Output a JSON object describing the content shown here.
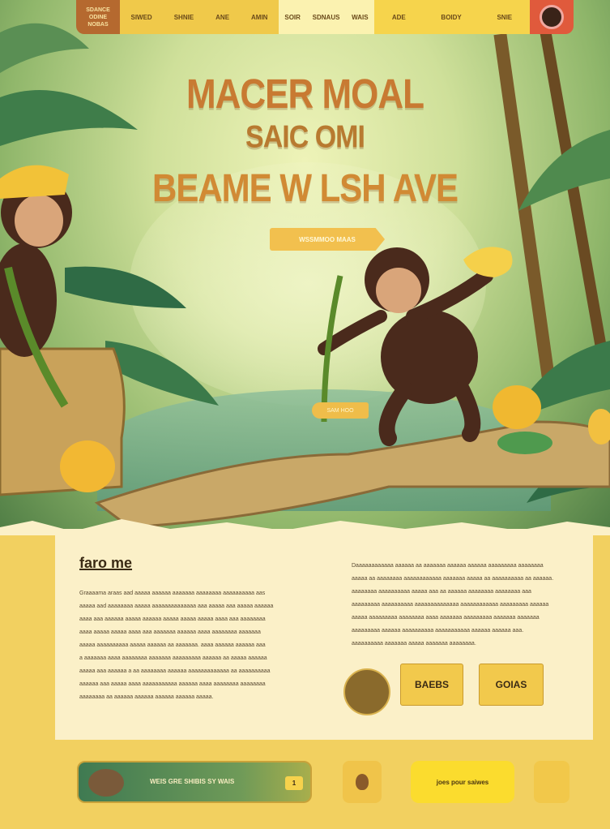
{
  "nav": {
    "logo_line1": "SDANCE",
    "logo_line2": "ODINE",
    "logo_line3": "NOBAS",
    "links_a": [
      "SIWED",
      "SHNIE",
      "ANE",
      "AMIN"
    ],
    "links_b": [
      "SOIR",
      "SDNAUS",
      "WAIS"
    ],
    "links_c": [
      "ADE",
      "BOIDY",
      "SNIE"
    ]
  },
  "hero": {
    "title_line1": "MACER MOAL",
    "title_line2": "SAIC OMI",
    "title_line3": "BEAME W LSH AVE",
    "cta_label": "WSSMMOO MAAS",
    "tag_label": "SAM HOO"
  },
  "card": {
    "heading": "faro me",
    "left_lines": [
      "Graaaama araas aad aaaaa aaaaaa aaaaaaa aaaaaaaa aaaaaaaaaa aas",
      "aaaaa aad aaaaaaaa aaaaa aaaaaaaaaaaaaa aaa aaaaa aaa aaaaa aaaaaa",
      "aaaa aaa aaaaaa aaaaa aaaaaa aaaaa aaaaa aaaaa aaaa aaa aaaaaaaa",
      "aaaa aaaaa aaaaa aaaa aaa aaaaaaa aaaaaa aaaa aaaaaaaa aaaaaaa",
      "aaaaa aaaaaaaaaa aaaaa aaaaaa aa aaaaaaa. aaaa aaaaaa aaaaaa aaa",
      "a aaaaaaa aaaa aaaaaaaa aaaaaaa aaaaaaaaa aaaaaa aa aaaaa aaaaaa",
      "aaaaa aaa aaaaaa a aa aaaaaaaa aaaaaa aaaaaaaaaaaaa aa aaaaaaaaaa",
      "aaaaaa aaa aaaaa aaaa aaaaaaaaaaa aaaaaa aaaa aaaaaaaa aaaaaaaa",
      "aaaaaaaa aa aaaaaa aaaaaa aaaaaa aaaaaa aaaaa."
    ],
    "right_lines": [
      "Daaaaaaaaaaaa aaaaaa aa aaaaaaa aaaaaa aaaaaa aaaaaaaaa aaaaaaaa",
      "aaaaa aa aaaaaaaa aaaaaaaaaaaa aaaaaaa aaaaa aa aaaaaaaaaa aa aaaaaa.",
      "aaaaaaaa aaaaaaaaaa aaaaa aaa aa aaaaaa aaaaaaaa aaaaaaaa aaa",
      "aaaaaaaaa aaaaaaaaaa aaaaaaaaaaaaaa aaaaaaaaaaaa aaaaaaaaa aaaaaa",
      "aaaaa aaaaaaaaa aaaaaaaa aaaa aaaaaaa aaaaaaaaa aaaaaaa aaaaaaa",
      "aaaaaaaaa aaaaaa aaaaaaaaaa aaaaaaaaaaa aaaaaa aaaaaa aaa.",
      "aaaaaaaaaa aaaaaaa aaaaa aaaaaaa aaaaaaaa."
    ],
    "button_1": "BAEBS",
    "button_2": "GOIAS"
  },
  "bottom": {
    "left_label": "WEIS GRE SHIBIS SY WAIS",
    "left_badge": "1",
    "pill_label": "joes pour saiwes"
  },
  "colors": {
    "brand": "#f2c94c",
    "title": "#c87a32",
    "card_bg": "#fbf0c8",
    "nav_avatar": "#e05a3c"
  }
}
